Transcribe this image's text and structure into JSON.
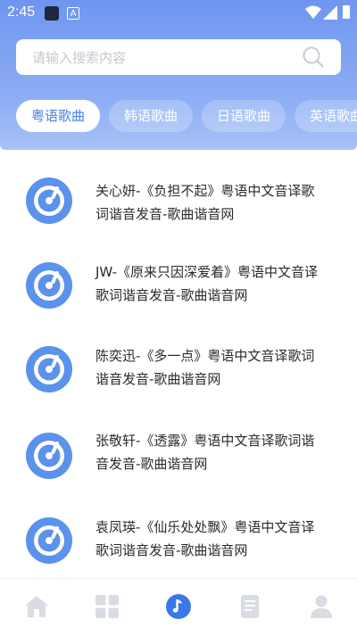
{
  "status_bar": {
    "time": "2:45",
    "a_label": "A"
  },
  "search": {
    "placeholder": "请输入搜索内容"
  },
  "tabs": [
    {
      "label": "粤语歌曲",
      "active": true
    },
    {
      "label": "韩语歌曲",
      "active": false
    },
    {
      "label": "日语歌曲",
      "active": false
    },
    {
      "label": "英语歌曲",
      "active": false
    }
  ],
  "songs": [
    {
      "line1": "关心妍-《负担不起》粤语中文音译歌",
      "line2": "词谐音发音-歌曲谐音网"
    },
    {
      "line1": "JW-《原来只因深爱着》粤语中文音译",
      "line2": "歌词谐音发音-歌曲谐音网"
    },
    {
      "line1": "陈奕迅-《多一点》粤语中文音译歌词",
      "line2": "谐音发音-歌曲谐音网"
    },
    {
      "line1": "张敬轩-《透露》粤语中文音译歌词谐",
      "line2": "音发音-歌曲谐音网"
    },
    {
      "line1": "袁凤瑛-《仙乐处处飘》粤语中文音译",
      "line2": "歌词谐音发音-歌曲谐音网"
    }
  ],
  "bottom_nav": [
    {
      "icon": "home-icon",
      "active": false
    },
    {
      "icon": "grid-icon",
      "active": false
    },
    {
      "icon": "music-note-icon",
      "active": true
    },
    {
      "icon": "document-icon",
      "active": false
    },
    {
      "icon": "user-icon",
      "active": false
    }
  ],
  "colors": {
    "accent": "#4a7ee6",
    "header_top": "#6f95f0",
    "inactive_nav": "#d9dce3"
  }
}
